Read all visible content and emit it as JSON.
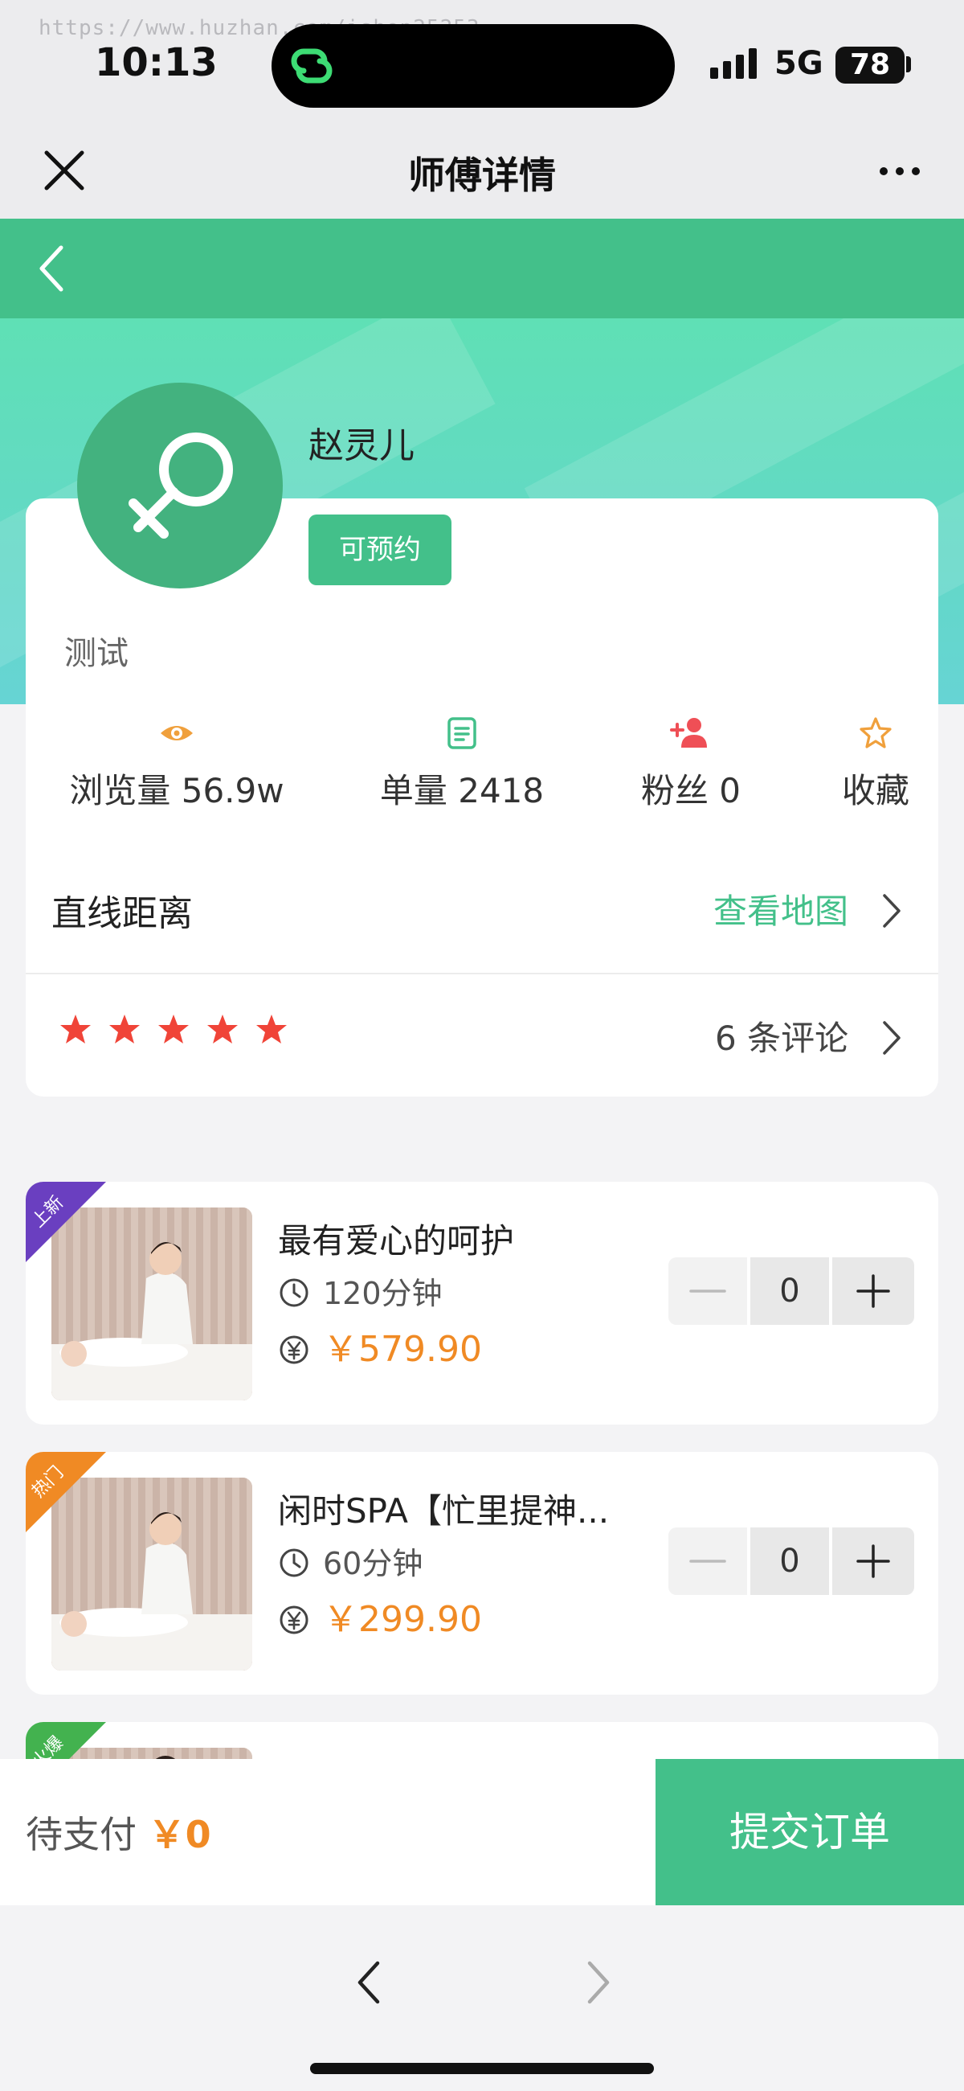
{
  "status_bar": {
    "watermark": "https://www.huzhan.com/ishop25253",
    "time": "10:13",
    "network": "5G",
    "battery": "78"
  },
  "nav": {
    "title": "师傅详情"
  },
  "profile": {
    "name": "赵灵儿",
    "status_tag": "可预约",
    "description": "测试",
    "stats": [
      {
        "icon": "eye-icon",
        "label": "浏览量 56.9w"
      },
      {
        "icon": "clipboard-icon",
        "label": "单量 2418"
      },
      {
        "icon": "add-user-icon",
        "label": "粉丝 0"
      },
      {
        "icon": "star-outline-icon",
        "label": "收藏"
      }
    ],
    "distance_label": "直线距离",
    "map_link": "查看地图",
    "rating_stars": 5,
    "review_link": "6 条评论"
  },
  "services": [
    {
      "ribbon": "上新",
      "ribbon_color": "#6a3fc0",
      "title": "最有爱心的呵护",
      "duration": "120分钟",
      "price": "￥579.90",
      "quantity": "0"
    },
    {
      "ribbon": "热门",
      "ribbon_color": "#f08a24",
      "title": "闲时SPA【忙里提神...",
      "duration": "60分钟",
      "price": "￥299.90",
      "quantity": "0"
    },
    {
      "ribbon": "火爆",
      "ribbon_color": "#43b24f"
    }
  ],
  "checkout": {
    "pay_label": "待支付",
    "pay_amount": "￥0",
    "submit_label": "提交订单"
  },
  "colors": {
    "primary": "#43c08a",
    "price": "#f08a24",
    "star": "#f04438"
  }
}
